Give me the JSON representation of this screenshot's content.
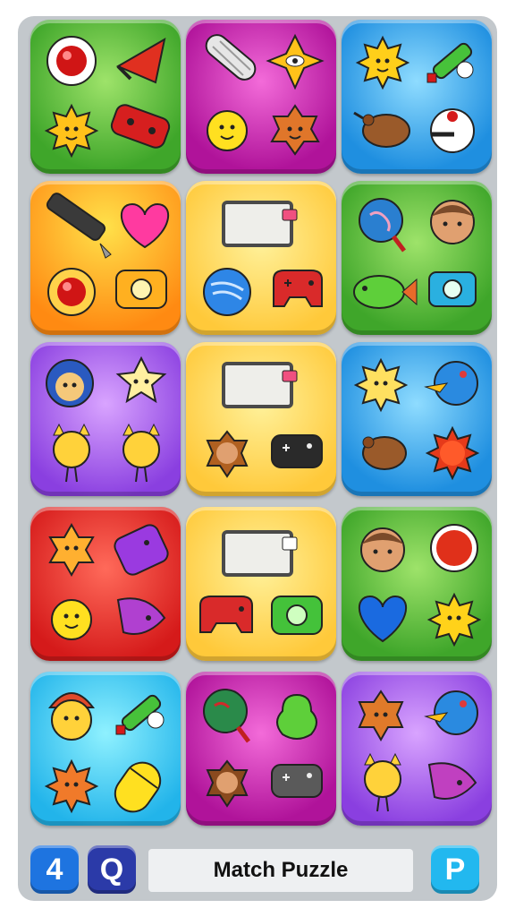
{
  "board": {
    "colors": {
      "green": "#4cb52f",
      "magenta": "#c61fb0",
      "blue": "#2d9ae6",
      "orange": "#ff9a1a",
      "yellow": "#ffd04a",
      "purple": "#9a4ee6",
      "red": "#de2a20",
      "cyan": "#2fbdee"
    },
    "tiles": [
      {
        "color": "green",
        "icons": [
          "red-button-icon",
          "megaphone-icon",
          "sun-face-icon",
          "handheld-console-icon"
        ]
      },
      {
        "color": "magenta",
        "icons": [
          "corn-cob-icon",
          "star-eye-icon",
          "sun-face-icon",
          "star-face-icon"
        ]
      },
      {
        "color": "blue",
        "icons": [
          "sun-face-icon",
          "green-syringe-icon",
          "kiwi-bird-icon",
          "snowman-head-icon"
        ]
      },
      {
        "color": "orange",
        "icons": [
          "pen-icon",
          "heart-icon",
          "red-button-icon",
          "camera-icon"
        ]
      },
      {
        "color": "yellow",
        "icons": [
          "screen-card-icon",
          "blue-ball-icon",
          "gamepad-icon"
        ]
      },
      {
        "color": "green",
        "icons": [
          "globe-lollipop-icon",
          "boy-face-icon",
          "fish-icon",
          "camera-icon"
        ]
      },
      {
        "color": "purple",
        "icons": [
          "cone-face-icon",
          "star-face-icon",
          "cat-face-icon",
          "cat-face-icon"
        ]
      },
      {
        "color": "yellow",
        "icons": [
          "screen-card-icon",
          "star-face-icon",
          "gamepad-icon"
        ]
      },
      {
        "color": "blue",
        "icons": [
          "sun-face-icon",
          "bird-ball-icon",
          "kiwi-bird-icon",
          "red-sun-icon"
        ]
      },
      {
        "color": "red",
        "icons": [
          "star-face-icon",
          "handheld-console-icon",
          "sun-face-icon",
          "bird-icon"
        ]
      },
      {
        "color": "yellow",
        "icons": [
          "screen-card-icon",
          "gamepad-icon",
          "camera-icon"
        ]
      },
      {
        "color": "green",
        "icons": [
          "boy-face-icon",
          "red-button-icon",
          "heart-icon",
          "sun-face-icon"
        ]
      },
      {
        "color": "cyan",
        "icons": [
          "hat-face-icon",
          "green-syringe-icon",
          "red-sun-icon",
          "pill-capsule-icon"
        ]
      },
      {
        "color": "magenta",
        "icons": [
          "globe-lollipop-icon",
          "pear-icon",
          "star-face-icon",
          "gamepad-icon"
        ]
      },
      {
        "color": "purple",
        "icons": [
          "star-face-icon",
          "bird-ball-icon",
          "cat-face-icon",
          "bird-icon"
        ]
      }
    ]
  },
  "controls": {
    "level_label": "4",
    "q_label": "Q",
    "title": "Match Puzzle",
    "p_label": "P"
  }
}
